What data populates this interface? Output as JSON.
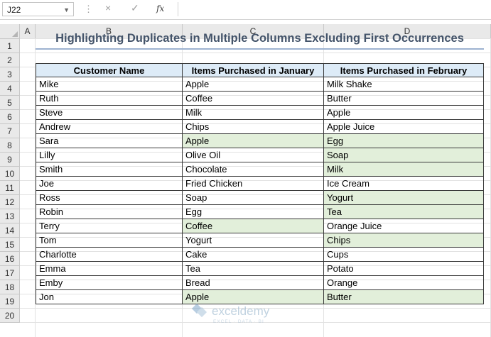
{
  "name_box": "J22",
  "formula_bar": {
    "cancel_icon": "×",
    "enter_icon": "✓",
    "fx_label": "fx",
    "formula": ""
  },
  "columns": [
    "A",
    "B",
    "C",
    "D"
  ],
  "rows": [
    "1",
    "2",
    "3",
    "4",
    "5",
    "6",
    "7",
    "8",
    "9",
    "10",
    "11",
    "12",
    "13",
    "14",
    "15",
    "16",
    "17",
    "18",
    "19",
    "20"
  ],
  "title": "Highlighting Duplicates in Multiple Columns Excluding First Occurrences",
  "table": {
    "headers": [
      "Customer Name",
      "Items Purchased in January",
      "Items Purchased in February"
    ],
    "rows": [
      {
        "name": "Mike",
        "jan": "Apple",
        "feb": "Milk Shake",
        "jan_hl": false,
        "feb_hl": false
      },
      {
        "name": "Ruth",
        "jan": "Coffee",
        "feb": "Butter",
        "jan_hl": false,
        "feb_hl": false
      },
      {
        "name": "Steve",
        "jan": "Milk",
        "feb": "Apple",
        "jan_hl": false,
        "feb_hl": false
      },
      {
        "name": "Andrew",
        "jan": "Chips",
        "feb": "Apple Juice",
        "jan_hl": false,
        "feb_hl": false
      },
      {
        "name": "Sara",
        "jan": "Apple",
        "feb": "Egg",
        "jan_hl": true,
        "feb_hl": true
      },
      {
        "name": " Lilly",
        "jan": "Olive Oil",
        "feb": "Soap",
        "jan_hl": false,
        "feb_hl": true
      },
      {
        "name": "Smith",
        "jan": "Chocolate",
        "feb": "Milk",
        "jan_hl": false,
        "feb_hl": true
      },
      {
        "name": "Joe",
        "jan": "Fried Chicken",
        "feb": "Ice Cream",
        "jan_hl": false,
        "feb_hl": false
      },
      {
        "name": "Ross",
        "jan": "Soap",
        "feb": "Yogurt",
        "jan_hl": false,
        "feb_hl": true
      },
      {
        "name": "Robin",
        "jan": "Egg",
        "feb": "Tea",
        "jan_hl": false,
        "feb_hl": true
      },
      {
        "name": "Terry",
        "jan": "Coffee",
        "feb": "Orange Juice",
        "jan_hl": true,
        "feb_hl": false
      },
      {
        "name": "Tom",
        "jan": "Yogurt",
        "feb": "Chips",
        "jan_hl": false,
        "feb_hl": true
      },
      {
        "name": "Charlotte",
        "jan": "Cake",
        "feb": "Cups",
        "jan_hl": false,
        "feb_hl": false
      },
      {
        "name": "Emma",
        "jan": "Tea",
        "feb": "Potato",
        "jan_hl": false,
        "feb_hl": false
      },
      {
        "name": "Emby",
        "jan": "Bread",
        "feb": "Orange",
        "jan_hl": false,
        "feb_hl": false
      },
      {
        "name": "Jon",
        "jan": "Apple",
        "feb": "Butter",
        "jan_hl": true,
        "feb_hl": true
      }
    ]
  },
  "watermark": {
    "brand": "exceldemy",
    "tagline": "EXCEL · DATA · BI"
  },
  "colors": {
    "header_fill": "#ddebf7",
    "highlight_fill": "#e2efda",
    "title_text": "#44546a",
    "title_underline": "#9db2d0"
  }
}
